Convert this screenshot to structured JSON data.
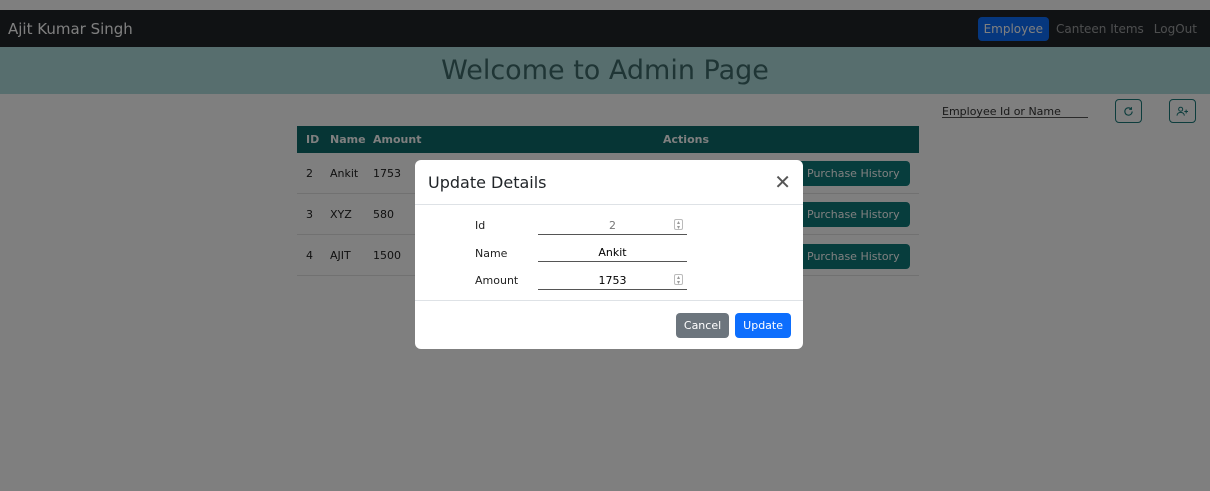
{
  "navbar": {
    "brand": "Ajit Kumar Singh",
    "links": [
      {
        "label": "Employee",
        "active": true
      },
      {
        "label": "Canteen Items",
        "active": false
      },
      {
        "label": "LogOut",
        "active": false
      }
    ]
  },
  "banner": {
    "title": "Welcome to Admin Page"
  },
  "search": {
    "placeholder": "Employee Id or Name"
  },
  "table": {
    "headers": [
      "ID",
      "Name",
      "Amount",
      "Actions"
    ],
    "rows": [
      {
        "id": "2",
        "name": "Ankit",
        "amount": "1753"
      },
      {
        "id": "3",
        "name": "XYZ",
        "amount": "580"
      },
      {
        "id": "4",
        "name": "AJIT",
        "amount": "1500"
      }
    ],
    "action_label": "Purchase History"
  },
  "modal": {
    "title": "Update Details",
    "fields": [
      {
        "label": "Id",
        "value": "2"
      },
      {
        "label": "Name",
        "value": "Ankit"
      },
      {
        "label": "Amount",
        "value": "1753"
      }
    ],
    "cancel_label": "Cancel",
    "update_label": "Update"
  },
  "icons": [
    "refresh-icon",
    "add-user-icon",
    "close-icon",
    "spinner-icon"
  ],
  "colors": {
    "navbar": "#212529",
    "banner": "#afdcdc",
    "teal": "#0c6b6b",
    "primary": "#0d6efd",
    "secondary": "#6c757d"
  }
}
